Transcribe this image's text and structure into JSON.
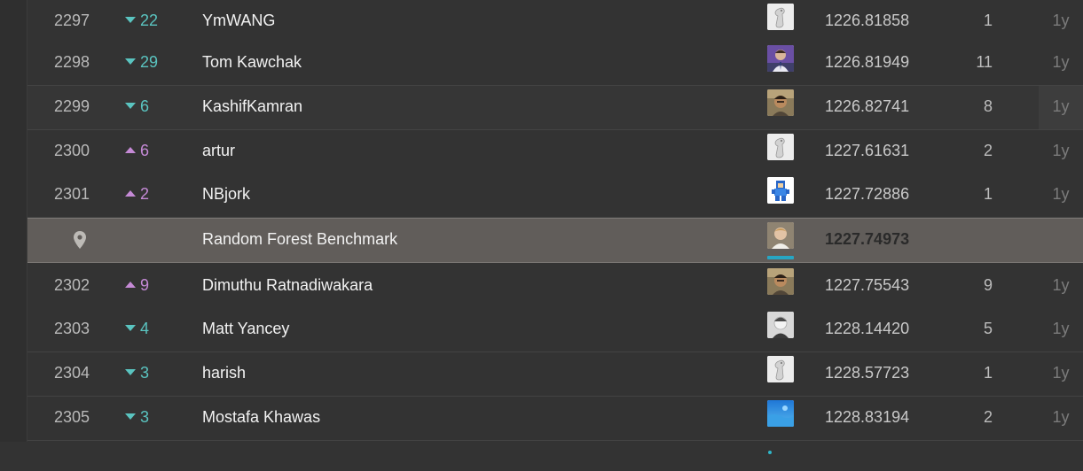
{
  "rows": [
    {
      "rank": "2297",
      "dir": "down",
      "change": "22",
      "name": "YmWANG",
      "avatar": "goose",
      "score": "1226.81858",
      "entries": "1",
      "last": "1y",
      "dots": 1
    },
    {
      "rank": "2298",
      "dir": "down",
      "change": "29",
      "name": "Tom Kawchak",
      "avatar": "photo-purple",
      "score": "1226.81949",
      "entries": "11",
      "last": "1y",
      "dots": 1
    },
    {
      "rank": "2299",
      "dir": "down",
      "change": "6",
      "name": "KashifKamran",
      "avatar": "photo-face",
      "score": "1226.82741",
      "entries": "8",
      "last": "1y",
      "dots": 1
    },
    {
      "rank": "2300",
      "dir": "up",
      "change": "6",
      "name": "artur",
      "avatar": "goose",
      "score": "1227.61631",
      "entries": "2",
      "last": "1y",
      "dots": 1
    },
    {
      "rank": "2301",
      "dir": "up",
      "change": "2",
      "name": "NBjork",
      "avatar": "pixel-robot",
      "score": "1227.72886",
      "entries": "1",
      "last": "1y",
      "dots": 2
    },
    {
      "benchmark": true,
      "name": "Random Forest Benchmark",
      "avatar": "photo-portrait",
      "score": "1227.74973",
      "icon": "map-pin-icon"
    },
    {
      "rank": "2302",
      "dir": "up",
      "change": "9",
      "name": "Dimuthu Ratnadiwakara",
      "avatar": "photo-face",
      "score": "1227.75543",
      "entries": "9",
      "last": "1y",
      "dots": 1
    },
    {
      "rank": "2303",
      "dir": "down",
      "change": "4",
      "name": "Matt Yancey",
      "avatar": "photo-bw",
      "score": "1228.14420",
      "entries": "5",
      "last": "1y",
      "dots": 2
    },
    {
      "rank": "2304",
      "dir": "down",
      "change": "3",
      "name": "harish",
      "avatar": "goose",
      "score": "1228.57723",
      "entries": "1",
      "last": "1y",
      "dots": 1
    },
    {
      "rank": "2305",
      "dir": "down",
      "change": "3",
      "name": "Mostafa Khawas",
      "avatar": "photo-water",
      "score": "1228.83194",
      "entries": "2",
      "last": "1y",
      "dots": 1
    }
  ],
  "colors": {
    "down": "#5ac4c0",
    "up": "#c58ad6",
    "benchmark_row": "#615d5a",
    "tier_dot": "#2fb6c9"
  }
}
